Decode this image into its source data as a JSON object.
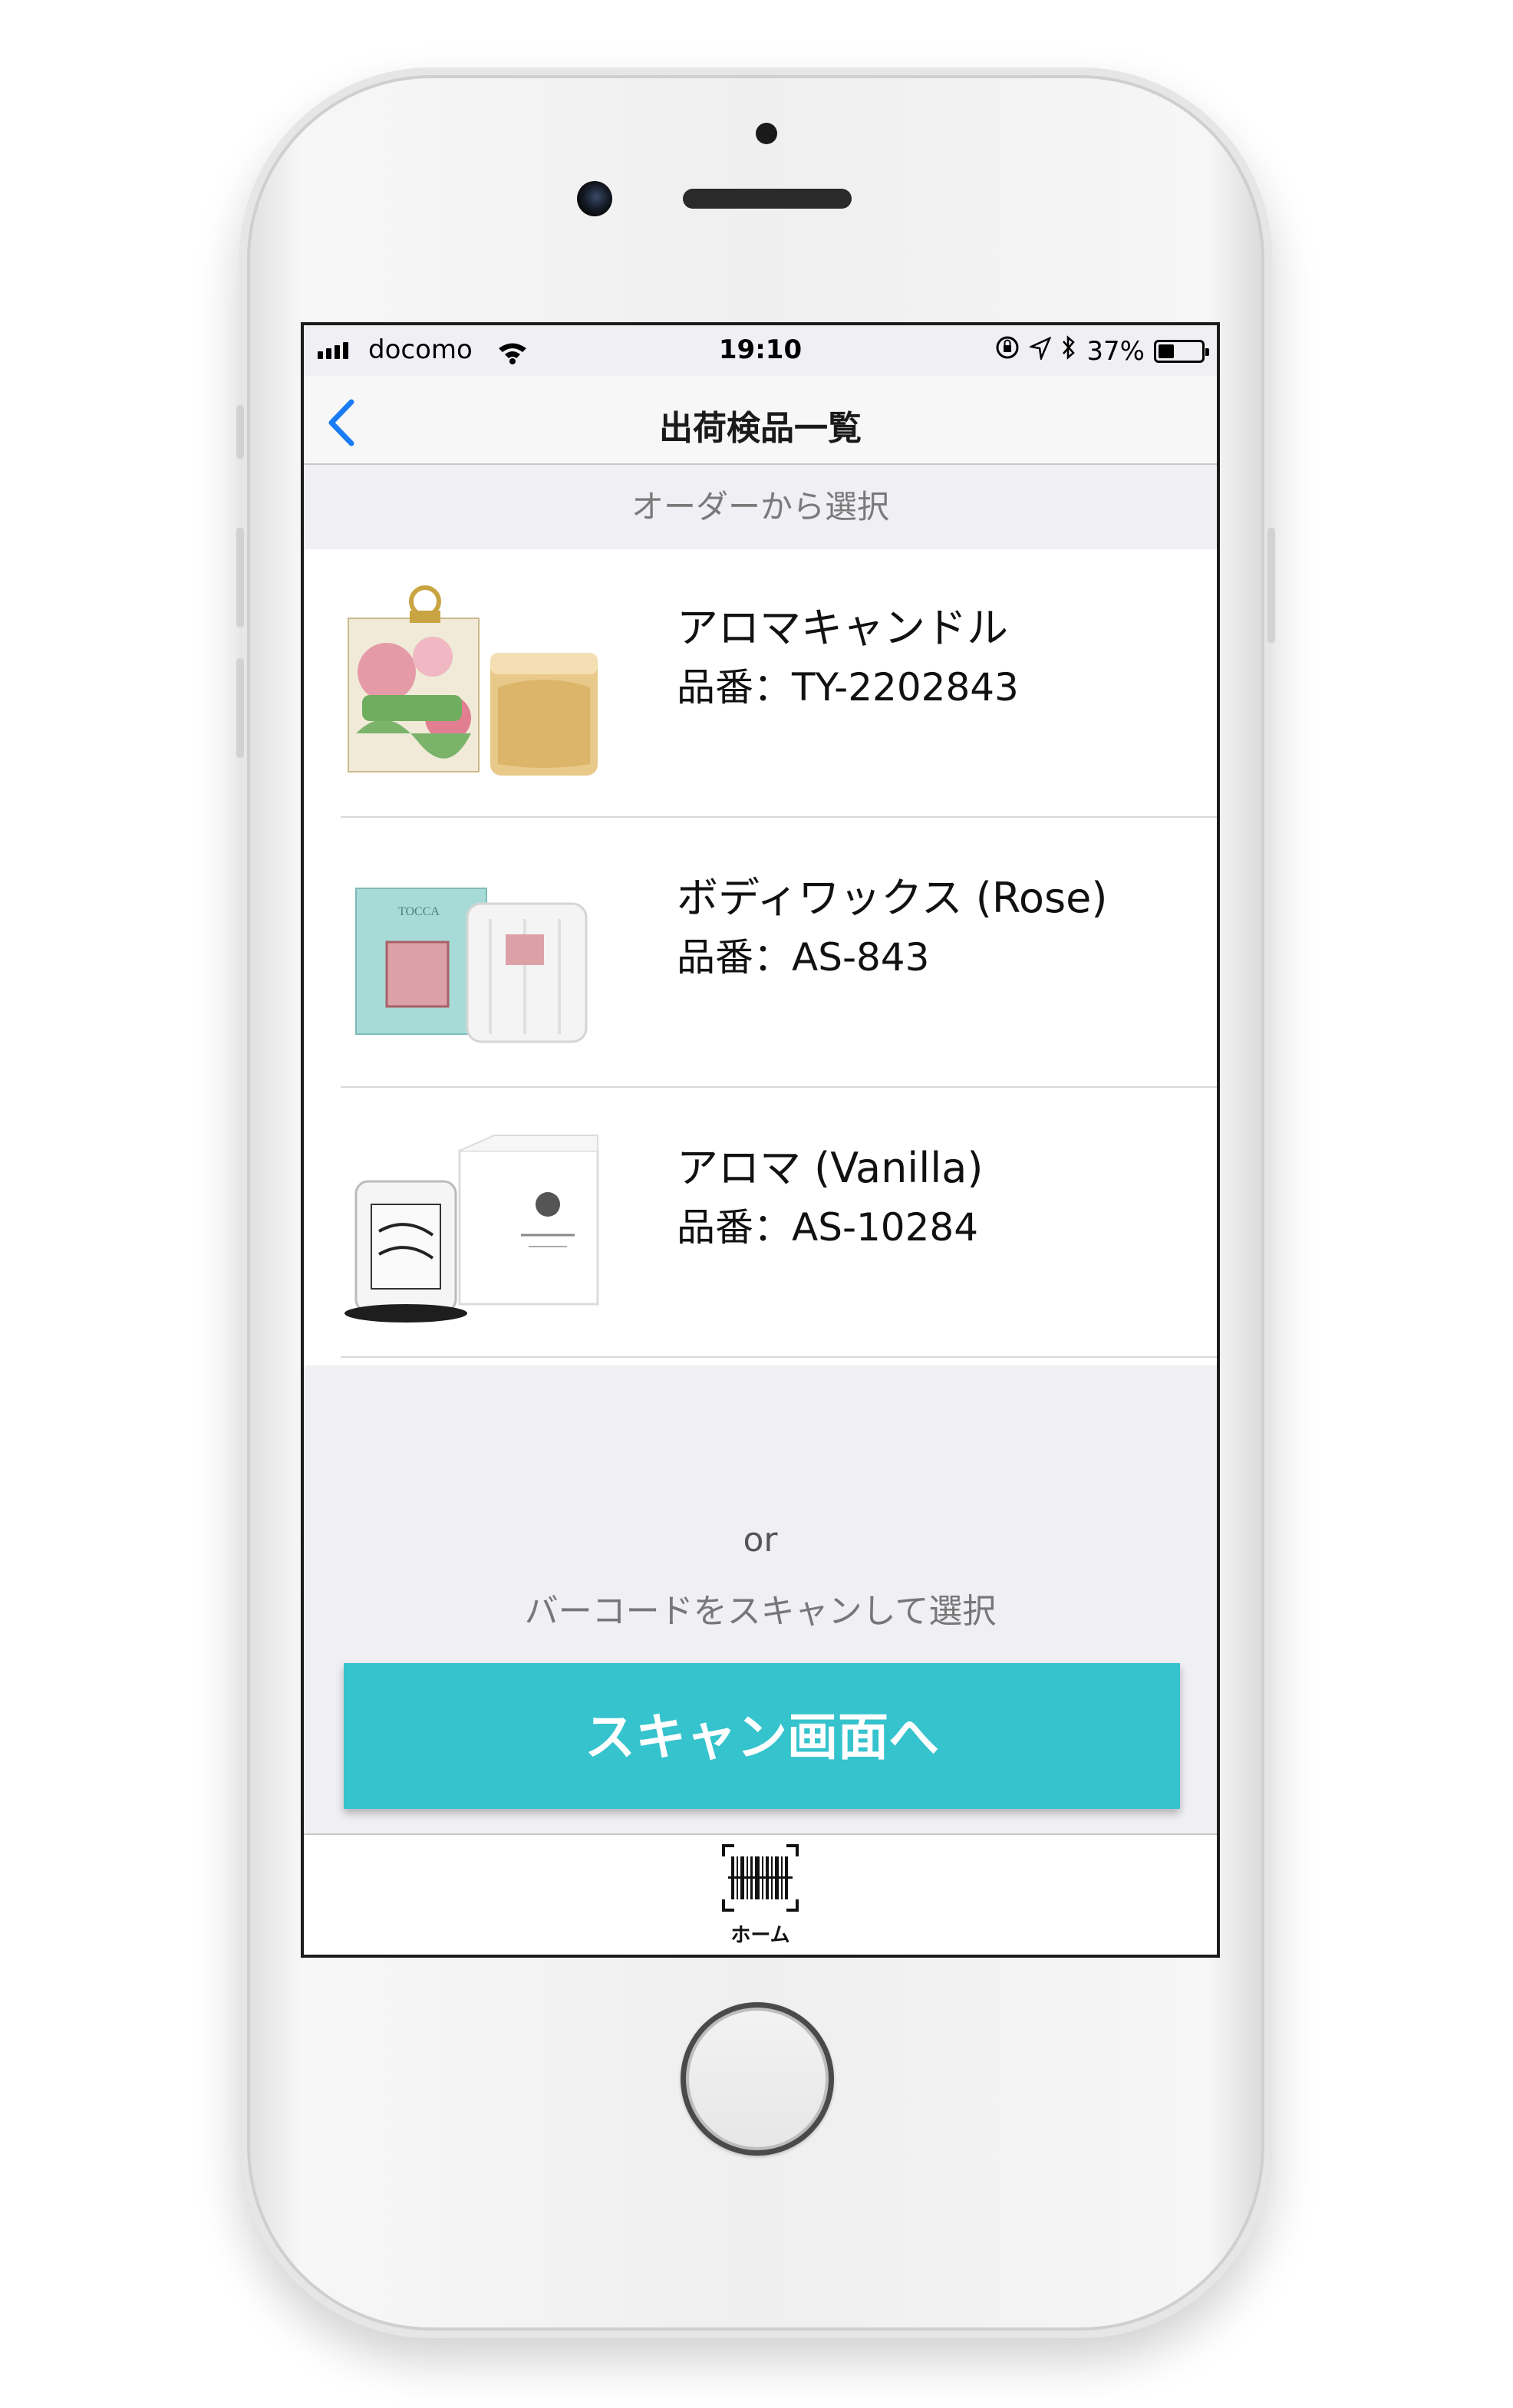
{
  "status_bar": {
    "carrier": "docomo",
    "time": "19:10",
    "battery": "37%",
    "battery_level": 0.37
  },
  "navbar": {
    "title": "出荷検品一覧",
    "back_icon": "chevron-left-icon"
  },
  "section_header": "オーダーから選択",
  "products": [
    {
      "name": "アロマキャンドル",
      "code": "品番：TY-2202843",
      "image": "peony-candle-image"
    },
    {
      "name": "ボディワックス (Rose)",
      "code": "品番：AS-843",
      "image": "tocca-candle-image"
    },
    {
      "name": "アロマ (Vanilla)",
      "code": "品番：AS-10284",
      "image": "white-musk-candle-image"
    }
  ],
  "or_text": "or",
  "scan_hint": "バーコードをスキャンして選択",
  "scan_button_label": "スキャン画面へ",
  "tabbar": {
    "home_label": "ホーム",
    "home_icon": "barcode-icon"
  },
  "colors": {
    "accent": "#35c3cd",
    "ios_blue": "#1a7cf5",
    "background": "#efeff4"
  }
}
